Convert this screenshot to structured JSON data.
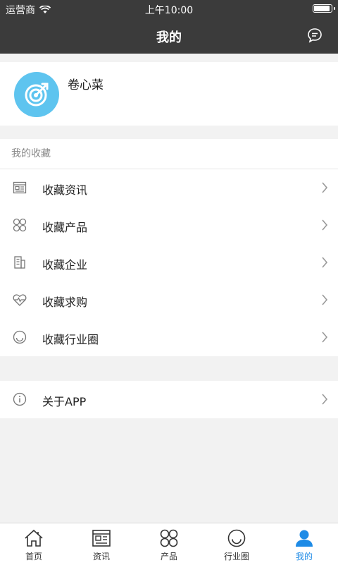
{
  "status_bar": {
    "carrier": "运营商",
    "time": "上午10:00",
    "battery_level": 1.0
  },
  "header": {
    "title": "我的"
  },
  "profile": {
    "name": "卷心菜"
  },
  "favorites": {
    "heading": "我的收藏",
    "items": [
      {
        "label": "收藏资讯",
        "icon": "news-icon"
      },
      {
        "label": "收藏产品",
        "icon": "grid-icon"
      },
      {
        "label": "收藏企业",
        "icon": "building-icon"
      },
      {
        "label": "收藏求购",
        "icon": "heartbeat-icon"
      },
      {
        "label": "收藏行业圈",
        "icon": "smile-icon"
      }
    ]
  },
  "about": {
    "label": "关于APP",
    "icon": "info-icon"
  },
  "tabbar": {
    "items": [
      {
        "label": "首页",
        "icon": "home-icon"
      },
      {
        "label": "资讯",
        "icon": "news-icon"
      },
      {
        "label": "产品",
        "icon": "grid-icon"
      },
      {
        "label": "行业圈",
        "icon": "smile-icon"
      },
      {
        "label": "我的",
        "icon": "user-icon"
      }
    ],
    "active_index": 4,
    "active_color": "#1e8be6"
  },
  "colors": {
    "header_bg": "#3b3b3b",
    "avatar_bg": "#5ec4ef",
    "page_bg": "#f2f2f2"
  }
}
